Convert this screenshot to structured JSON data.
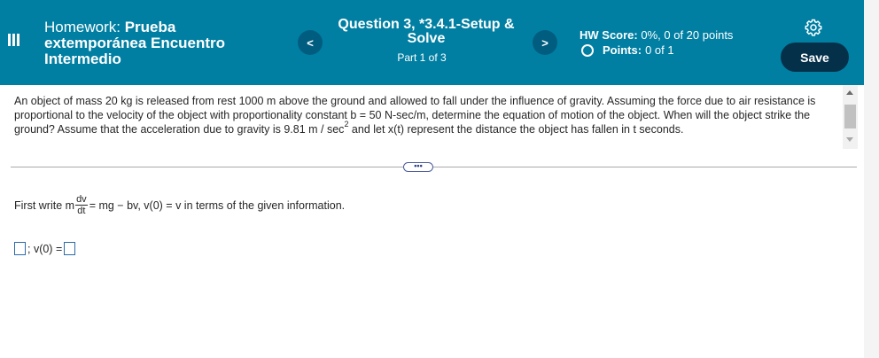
{
  "header": {
    "hw_prefix": "Homework:",
    "hw_name_first": "Prueba",
    "hw_name_rest": "extemporánea Encuentro Intermedio",
    "question_title": "Question 3, *3.4.1-Setup & Solve",
    "part_label": "Part 1 of 3",
    "prev_label": "<",
    "next_label": ">",
    "hw_score_label": "HW Score:",
    "hw_score_value": "0%, 0 of 20 points",
    "points_label": "Points:",
    "points_value": "0 of 1",
    "save_label": "Save",
    "icons": {
      "menu": "menu-icon",
      "settings": "gear-icon",
      "points": "circle-icon"
    },
    "colors": {
      "bar": "#007fa3",
      "nav_button": "#005d80",
      "save_button": "#053049"
    }
  },
  "problem": {
    "text_main": "An object of mass 20 kg is released from rest 1000 m above the ground and allowed to fall under the influence of gravity. Assuming the force due to air resistance is proportional to the velocity of the object with proportionality constant b = 50 N-sec/m, determine the equation of motion of the object. When will the object strike the ground? Assume that the acceleration due to gravity is 9.81 m / sec",
    "text_exp": "2",
    "text_end": " and let x(t) represent the distance the object has fallen in t seconds."
  },
  "divider": {
    "ellipsis_label": "•••"
  },
  "step": {
    "prefix": "First write m",
    "frac_num": "dv",
    "frac_den": "dt",
    "suffix": " = mg − bv, v(0) = v in terms of the given information."
  },
  "answer": {
    "box1_value": "",
    "separator": "; v(0) =",
    "box2_value": ""
  }
}
